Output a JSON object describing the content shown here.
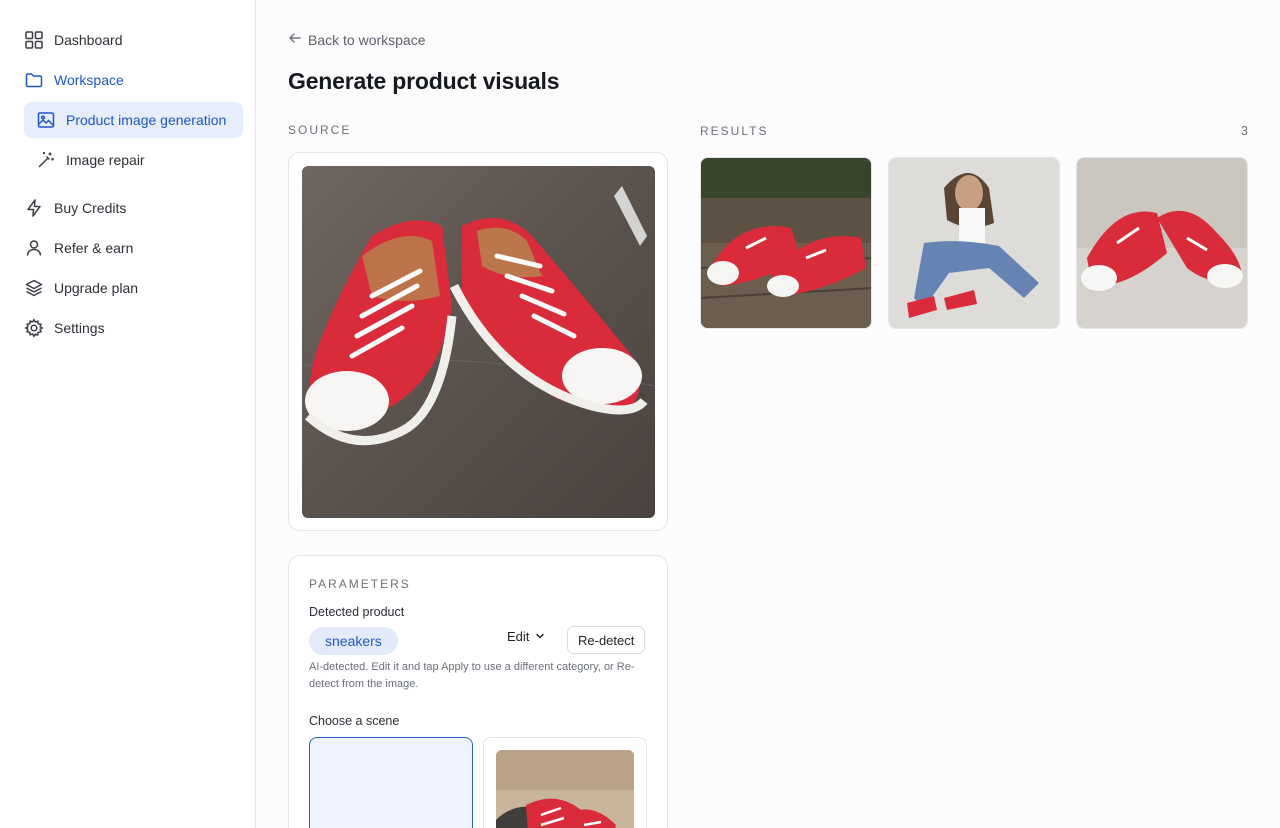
{
  "sidebar": {
    "items": [
      {
        "label": "Dashboard",
        "icon": "grid-icon"
      },
      {
        "label": "Workspace",
        "icon": "folder-icon"
      },
      {
        "label": "Product image generation",
        "icon": "image-icon"
      },
      {
        "label": "Image repair",
        "icon": "magic-wand-icon"
      },
      {
        "label": "Buy Credits",
        "icon": "lightning-icon"
      },
      {
        "label": "Refer & earn",
        "icon": "user-icon"
      },
      {
        "label": "Upgrade plan",
        "icon": "layers-icon"
      },
      {
        "label": "Settings",
        "icon": "gear-icon"
      }
    ]
  },
  "header": {
    "back_label": "Back to workspace",
    "title": "Generate product visuals"
  },
  "source": {
    "label": "SOURCE"
  },
  "results": {
    "label": "RESULTS",
    "count": "3"
  },
  "parameters": {
    "label": "PARAMETERS",
    "detected_label": "Detected product",
    "detected_value": "sneakers",
    "edit_label": "Edit",
    "redetect_label": "Re-detect",
    "help_text": "AI-detected. Edit it and tap Apply to use a different category, or Re-detect from the image.",
    "scene_label": "Choose a scene"
  },
  "colors": {
    "accent": "#1f56c7",
    "accent_bg": "#e6eefc",
    "sneaker_red": "#d92b3a"
  }
}
